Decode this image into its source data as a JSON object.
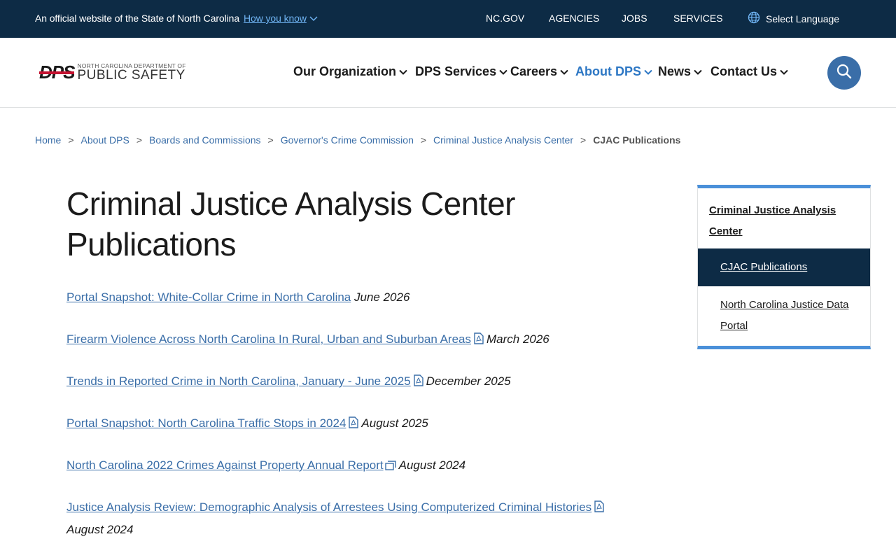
{
  "topbar": {
    "official_text": "An official website of the State of North Carolina",
    "how_you_know": "How you know",
    "links": [
      "NC.GOV",
      "AGENCIES",
      "JOBS",
      "SERVICES"
    ],
    "language": "Select Language"
  },
  "header": {
    "logo": {
      "mark": "DPS",
      "line1": "NORTH CAROLINA DEPARTMENT OF",
      "line2": "PUBLIC SAFETY"
    },
    "nav": [
      {
        "label": "Our Organization"
      },
      {
        "label": "DPS Services"
      },
      {
        "label": "Careers"
      },
      {
        "label": "About DPS",
        "active": true
      },
      {
        "label": "News"
      },
      {
        "label": "Contact Us"
      }
    ]
  },
  "breadcrumb": {
    "items": [
      "Home",
      "About DPS",
      "Boards and Commissions",
      "Governor's Crime Commission",
      "Criminal Justice Analysis Center"
    ],
    "current": "CJAC Publications",
    "separator": ">"
  },
  "page": {
    "title": "Criminal Justice Analysis Center Publications"
  },
  "publications": [
    {
      "title": "Portal Snapshot: White-Collar Crime in North Carolina",
      "icon": "none",
      "date": "June 2026"
    },
    {
      "title": "Firearm Violence Across North Carolina In Rural, Urban and Suburban Areas",
      "icon": "pdf-icon",
      "date": "March 2026"
    },
    {
      "title": "Trends in Reported Crime in North Carolina, January - June 2025",
      "icon": "pdf-icon",
      "date": "December 2025"
    },
    {
      "title": "Portal Snapshot: North Carolina Traffic Stops in 2024",
      "icon": "pdf-icon",
      "date": "August 2025"
    },
    {
      "title": "North Carolina 2022 Crimes Against Property Annual Report",
      "icon": "external-link-icon",
      "date": "August 2024"
    },
    {
      "title": "Justice Analysis Review: Demographic Analysis of Arrestees Using Computerized Criminal Histories",
      "icon": "pdf-icon",
      "date": "August 2024"
    }
  ],
  "sidebar": {
    "heading": "Criminal Justice Analysis Center",
    "active_item": "CJAC Publications",
    "item": "North Carolina Justice Data Portal"
  },
  "colors": {
    "topbar_bg": "#0d2b45",
    "link": "#3a6ea8",
    "active_nav": "#2d77c4",
    "accent_border": "#4a90d9",
    "search_button": "#3a6ea8"
  }
}
